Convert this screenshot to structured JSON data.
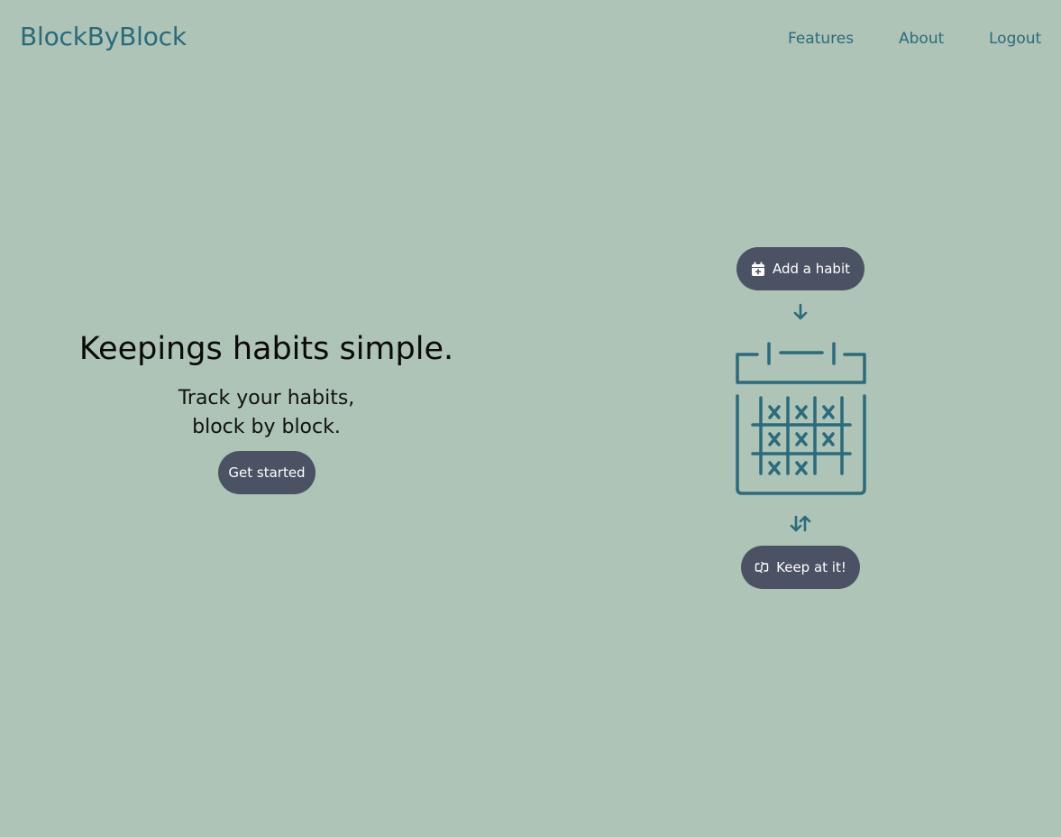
{
  "header": {
    "brand": "BlockByBlock",
    "nav": [
      "Features",
      "About",
      "Logout"
    ]
  },
  "hero": {
    "title": "Keepings habits simple.",
    "subtitle_line1": "Track your habits,",
    "subtitle_line2": "block by block.",
    "cta_label": "Get started"
  },
  "flow": {
    "add_habit_label": "Add a habit",
    "keep_at_it_label": "Keep at it!",
    "icons": [
      "calendar-plus-icon",
      "arrow-down-icon",
      "calendar-grid-icon",
      "arrows-up-down-icon",
      "repeat-icon"
    ]
  },
  "colors": {
    "background": "#aec4b6",
    "accent": "#2a6b7c",
    "button": "#4a5263",
    "button_text": "#ffffff",
    "heading": "#0a0a0a"
  }
}
